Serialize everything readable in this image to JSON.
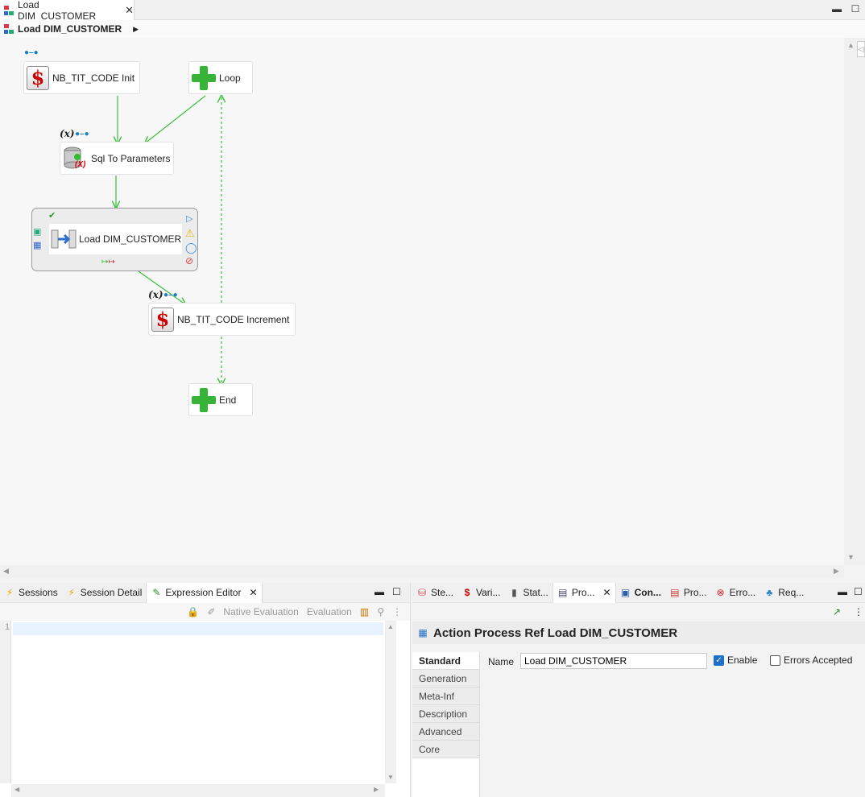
{
  "editor": {
    "tab_title": "Load DIM_CUSTOMER",
    "breadcrumb": "Load DIM_CUSTOMER"
  },
  "diagram": {
    "nodes": {
      "init": "NB_TIT_CODE Init",
      "loop": "Loop",
      "sql": "Sql To Parameters",
      "load": "Load DIM_CUSTOMER",
      "increment": "NB_TIT_CODE Increment",
      "end": "End"
    },
    "var_glyph": "(x)",
    "sql_var_glyph": "(X)"
  },
  "left_panel": {
    "tabs": [
      {
        "label": "Sessions",
        "icon": "bolt-icon"
      },
      {
        "label": "Session Detail",
        "icon": "bolt-icon"
      },
      {
        "label": "Expression Editor",
        "icon": "pencil-icon"
      }
    ],
    "toolbar": {
      "native_eval": "Native Evaluation",
      "eval": "Evaluation"
    },
    "line_number": "1"
  },
  "right_panel": {
    "tabs": [
      {
        "label": "Ste...",
        "icon": "steps-icon"
      },
      {
        "label": "Vari...",
        "icon": "dollar-icon"
      },
      {
        "label": "Stat...",
        "icon": "chart-icon"
      },
      {
        "label": "Pro...",
        "icon": "properties-icon"
      },
      {
        "label": "Con...",
        "icon": "console-icon"
      },
      {
        "label": "Pro...",
        "icon": "problems-icon"
      },
      {
        "label": "Erro...",
        "icon": "error-icon"
      },
      {
        "label": "Req...",
        "icon": "tree-icon"
      }
    ],
    "title": "Action Process Ref Load DIM_CUSTOMER",
    "sections": [
      "Standard",
      "Generation",
      "Meta-Inf",
      "Description",
      "Advanced",
      "Core"
    ],
    "name_label": "Name",
    "name_value": "Load DIM_CUSTOMER",
    "enable_label": "Enable",
    "errors_label": "Errors Accepted"
  }
}
